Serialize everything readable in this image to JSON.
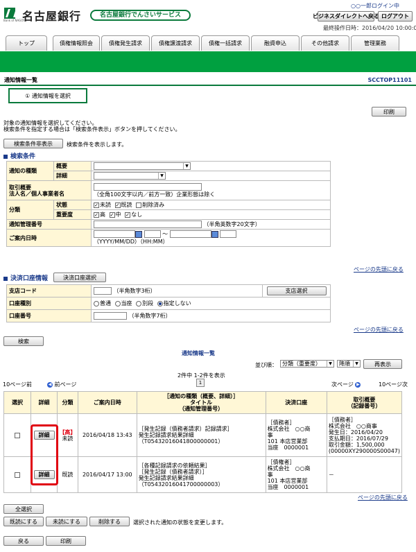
{
  "header": {
    "bank_name": "名古屋銀行",
    "bank_sub": "Bank of NAGOYA",
    "service_name": "名古屋銀行でんさいサービス",
    "login_user": "○○一郎ログイン中",
    "btn_bizdirect": "ビジネスダイレクトへ戻る",
    "btn_logout": "ログアウト",
    "last_operation": "最終操作日時：2016/04/20 10:00:00"
  },
  "tabs": [
    "トップ",
    "債権情報照会",
    "債権発生請求",
    "債権譲渡請求",
    "債権一括請求",
    "融資申込",
    "その他請求",
    "管理業務"
  ],
  "page": {
    "title": "通知情報一覧",
    "code": "SCCTOP11101",
    "step": "① 通知情報を選択",
    "print_button": "印刷",
    "instruction1": "対象の通知情報を選択してください。",
    "instruction2": "検索条件を指定する場合は「検索条件表示」ボタンを押してください。",
    "toggle_button": "検索条件非表示",
    "toggle_note": "検索条件を表示します。"
  },
  "search": {
    "section_title": "検索条件",
    "label_type": "通知の種類",
    "label_summary": "概要",
    "label_detail": "詳細",
    "label_party": "取引概要\n法人名／個人事業者名",
    "party_note": "（全角100文字以内／前方一致）企業形態は除く",
    "label_class": "分類",
    "label_status": "状態",
    "status_options": [
      "未読",
      "既読",
      "削除済み"
    ],
    "status_checked": [
      true,
      true,
      false
    ],
    "label_priority": "重要度",
    "priority_options": [
      "高",
      "中",
      "なし"
    ],
    "priority_checked": [
      true,
      true,
      true
    ],
    "label_mgmt_no": "通知管理番号",
    "mgmt_note": "（半角英数字20文字）",
    "label_date": "ご案内日時",
    "date_sep": "～",
    "date_note": "（YYYY/MM/DD）（HH:MM）",
    "top_link": "ページの先頭に戻る"
  },
  "account": {
    "section_title": "決済口座情報",
    "select_button": "決済口座選択",
    "label_branch": "支店コード",
    "branch_note": "（半角数字3桁）",
    "branch_button": "支店選択",
    "label_type": "口座種別",
    "type_options": [
      "普通",
      "当座",
      "別段",
      "指定しない"
    ],
    "type_selected": 3,
    "label_number": "口座番号",
    "number_note": "（半角数字7桁）",
    "top_link": "ページの先頭に戻る",
    "search_button": "検索"
  },
  "list": {
    "title": "通知情報一覧",
    "sort_label": "並び順：",
    "sort_value": "分類（重要度）",
    "order_value": "降順",
    "resort_button": "再表示",
    "count": "2件中 1-2件を表示",
    "prev10": "10ページ前",
    "prev": "前ページ",
    "page_no": "1",
    "next": "次ページ",
    "next10": "10ページ次",
    "headers": {
      "select": "選択",
      "detail": "詳細",
      "class": "分類",
      "date": "ご案内日時",
      "type_l1": "［通知の種類（概要、詳細）］",
      "type_l2": "タイトル",
      "type_l3": "（通知管理番号）",
      "account": "決済口座",
      "deal_l1": "取引概要",
      "deal_l2": "（記録番号）"
    },
    "detail_button": "詳細",
    "rows": [
      {
        "priority": "【高】",
        "status": "未読",
        "date": "2016/04/18 13:43",
        "type_l1": "［発生記録（債務者請求）記録請求］",
        "type_l2": "発生記録請求結果詳細",
        "type_l3": "（T05432016041800000001）",
        "acc_l1": "［債務者］",
        "acc_l2": "株式会社　○○商",
        "acc_l3": "事",
        "acc_l4": "101 本店営業部",
        "acc_l5": "当座　0000001",
        "deal_l1": "［債務者］",
        "deal_l2": "株式会社　○○商事",
        "deal_l3": "発生日：2016/04/20",
        "deal_l4": "支払期日：2016/07/29",
        "deal_l5": "取引金額：1,500,000",
        "deal_l6": "(00000XY290000S00047)"
      },
      {
        "priority": "",
        "status": "既読",
        "date": "2016/04/17 13:00",
        "type_l1": "［各種記録請求の依頼結果］",
        "type_l2": "［発生記録（債務者請求）］",
        "type_l3": "発生記録請求結果詳細",
        "type_l4": "（T05432016041700000003）",
        "acc_l1": "［債権者］",
        "acc_l2": "株式会社　○○商",
        "acc_l3": "事",
        "acc_l4": "101 本店営業部",
        "acc_l5": "当座　0000001",
        "deal_l1": "－"
      }
    ],
    "top_link": "ページの先頭に戻る"
  },
  "footer": {
    "select_all": "全選択",
    "mark_read": "既読にする",
    "mark_unread": "未読にする",
    "delete": "削除する",
    "note": "選択された通知の状態を変更します。",
    "back": "戻る",
    "print": "印刷"
  }
}
